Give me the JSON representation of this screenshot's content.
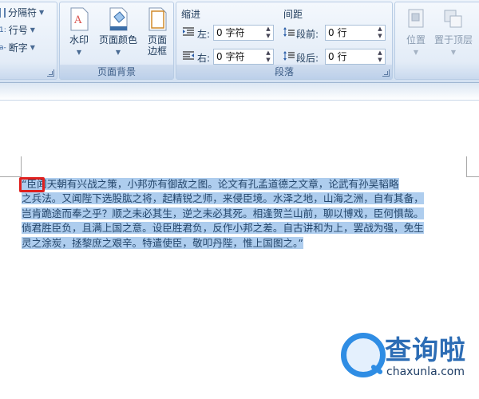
{
  "ribbon": {
    "layout_group": {
      "columns_label": "分隔符",
      "line_numbers_label": "行号",
      "hyphenation_label": "断字"
    },
    "page_background": {
      "caption": "页面背景",
      "watermark_label": "水印",
      "page_color_label": "页面颜色",
      "page_borders_label_line1": "页面",
      "page_borders_label_line2": "边框"
    },
    "paragraph": {
      "caption": "段落",
      "indent_header": "缩进",
      "spacing_header": "间距",
      "indent_left_label": "左:",
      "indent_left_value": "0 字符",
      "indent_right_label": "右:",
      "indent_right_value": "0 字符",
      "spacing_before_label": "段前:",
      "spacing_before_value": "0 行",
      "spacing_after_label": "段后:",
      "spacing_after_value": "0 行"
    },
    "arrange": {
      "position_label": "位置",
      "bring_front_label": "置于顶层"
    }
  },
  "document": {
    "line1": "“臣闻天朝有兴战之策，小邦亦有御敌之图。论文有孔孟道德之文章，论武有孙吴韬略",
    "line2": "之兵法。又闻陛下选股肱之将，起精锐之师，来侵臣境。水泽之地，山海之洲，自有其备，",
    "line3": "岂肯跪途而奉之乎？顺之未必其生，逆之未必其死。相逢贺兰山前，聊以博戏，臣何惧哉。",
    "line4": "倘君胜臣负，且满上国之意。设臣胜君负，反作小邦之差。自古讲和为上，罢战为强，免生",
    "line5": "灵之涂炭，拯黎庶之艰辛。特遣使臣，敬叩丹陛，惟上国图之。”"
  },
  "watermark": {
    "cn": "查询啦",
    "en": "chaxunla.com"
  },
  "colors": {
    "selection": "#aecdee",
    "highlight_box": "#e0201e",
    "ribbon_bg": "#dde8f5"
  }
}
